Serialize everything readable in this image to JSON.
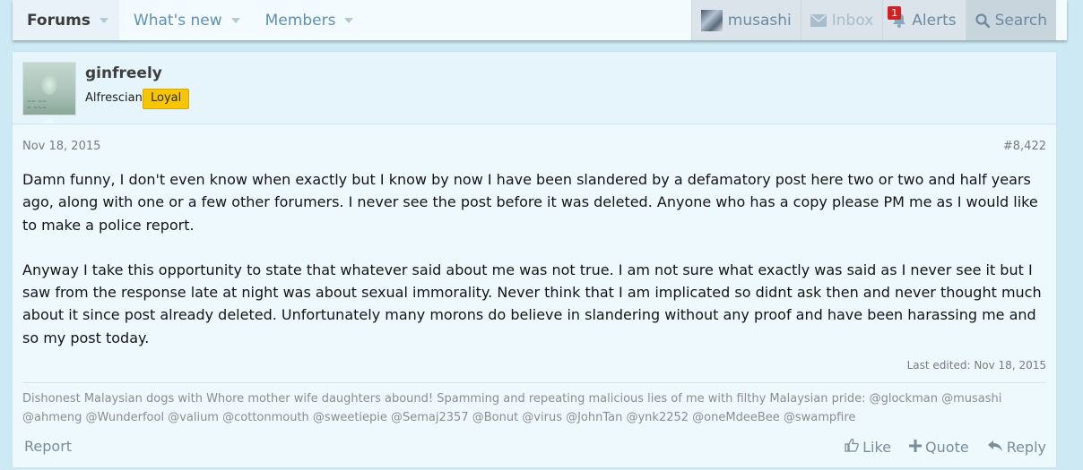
{
  "nav": {
    "tabs": [
      {
        "label": "Forums"
      },
      {
        "label": "What's new"
      },
      {
        "label": "Members"
      }
    ],
    "user": "musashi",
    "inbox": "Inbox",
    "alerts": "Alerts",
    "alerts_count": "1",
    "search": "Search"
  },
  "post": {
    "username": "ginfreely",
    "user_title": "Alfrescian",
    "badge": "Loyal",
    "date": "Nov 18, 2015",
    "number": "#8,422",
    "paragraphs": [
      "Damn funny, I don't even know when exactly but I know by now I have been slandered by a defamatory post here two or two and half years ago, along with one or a few other forumers. I never see the post before it was deleted. Anyone who has a copy please PM me as I would like to make a police report.",
      "Anyway I take this opportunity to state that whatever said about me was not true. I am not sure what exactly was said as I never see it but I saw from the response late at night was about sexual immorality. Never think that I am implicated so didnt ask then and never thought much about it since post already deleted. Unfortunately many morons do believe in slandering without any proof and have been harassing me and so my post today."
    ],
    "last_edited": "Last edited: Nov 18, 2015",
    "signature": "Dishonest Malaysian dogs with Whore mother wife daughters abound! Spamming and repeating malicious lies of me with filthy Malaysian pride: @glockman @musashi @ahmeng @Wunderfool @valium @cottonmouth @sweetiepie @Semaj2357 @Bonut @virus @JohnTan @ynk2252 @oneMdeeBee @swampfire",
    "report": "Report",
    "like": "Like",
    "quote": "Quote",
    "reply": "Reply"
  }
}
